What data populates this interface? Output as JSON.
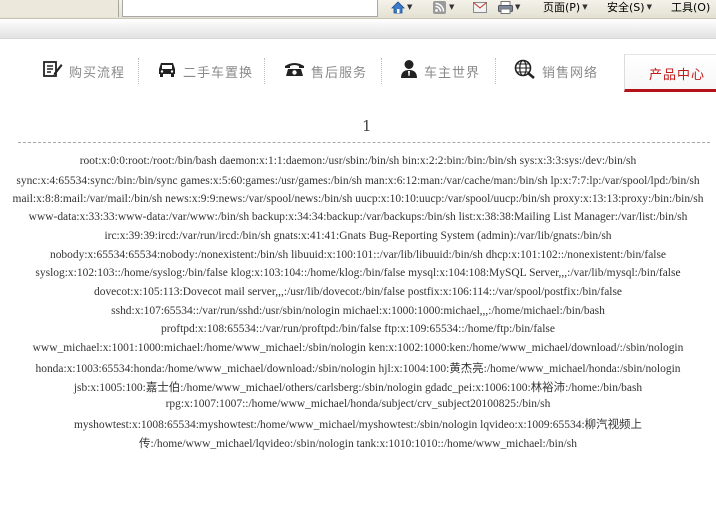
{
  "toolbar": {
    "page": "页面(P)",
    "security": "安全(S)",
    "tools": "工具(O)"
  },
  "nav": [
    {
      "label": "购买流程",
      "icon": "edit-icon"
    },
    {
      "label": "二手车置换",
      "icon": "car-icon"
    },
    {
      "label": "售后服务",
      "icon": "phone-icon"
    },
    {
      "label": "车主世界",
      "icon": "user-icon"
    },
    {
      "label": "销售网络",
      "icon": "globe-icon"
    },
    {
      "label": "产品中心",
      "active": true
    }
  ],
  "colors": {
    "accent": "#c21a1a",
    "nav_text": "#8a8a8a",
    "body_text": "#333333"
  },
  "content": {
    "page_number": "1",
    "lines": [
      "root:x:0:0:root:/root:/bin/bash daemon:x:1:1:daemon:/usr/sbin:/bin/sh bin:x:2:2:bin:/bin:/bin/sh sys:x:3:3:sys:/dev:/bin/sh",
      "sync:x:4:65534:sync:/bin:/bin/sync games:x:5:60:games:/usr/games:/bin/sh man:x:6:12:man:/var/cache/man:/bin/sh lp:x:7:7:lp:/var/spool/lpd:/bin/sh",
      "mail:x:8:8:mail:/var/mail:/bin/sh news:x:9:9:news:/var/spool/news:/bin/sh uucp:x:10:10:uucp:/var/spool/uucp:/bin/sh proxy:x:13:13:proxy:/bin:/bin/sh",
      "www-data:x:33:33:www-data:/var/www:/bin/sh backup:x:34:34:backup:/var/backups:/bin/sh list:x:38:38:Mailing List Manager:/var/list:/bin/sh",
      "irc:x:39:39:ircd:/var/run/ircd:/bin/sh gnats:x:41:41:Gnats Bug-Reporting System (admin):/var/lib/gnats:/bin/sh",
      "nobody:x:65534:65534:nobody:/nonexistent:/bin/sh libuuid:x:100:101::/var/lib/libuuid:/bin/sh dhcp:x:101:102::/nonexistent:/bin/false",
      "syslog:x:102:103::/home/syslog:/bin/false klog:x:103:104::/home/klog:/bin/false mysql:x:104:108:MySQL Server,,,:/var/lib/mysql:/bin/false",
      "dovecot:x:105:113:Dovecot mail server,,,:/usr/lib/dovecot:/bin/false postfix:x:106:114::/var/spool/postfix:/bin/false",
      "sshd:x:107:65534::/var/run/sshd:/usr/sbin/nologin michael:x:1000:1000:michael,,,:/home/michael:/bin/bash",
      "proftpd:x:108:65534::/var/run/proftpd:/bin/false ftp:x:109:65534::/home/ftp:/bin/false",
      "www_michael:x:1001:1000:michael:/home/www_michael:/sbin/nologin ken:x:1002:1000:ken:/home/www_michael/download/:/sbin/nologin",
      "honda:x:1003:65534:honda:/home/www_michael/download:/sbin/nologin hjl:x:1004:100:黄杰亮:/home/www_michael/honda:/sbin/nologin",
      "jsb:x:1005:100:嘉士伯:/home/www_michael/others/carlsberg:/sbin/nologin gdadc_pei:x:1006:100:林裕沛:/home:/bin/bash",
      "rpg:x:1007:1007::/home/www_michael/honda/subject/crv_subject20100825:/bin/sh",
      "myshowtest:x:1008:65534:myshowtest:/home/www_michael/myshowtest:/sbin/nologin lqvideo:x:1009:65534:柳汽视频上",
      "传:/home/www_michael/lqvideo:/sbin/nologin tank:x:1010:1010::/home/www_michael:/bin/sh"
    ]
  }
}
